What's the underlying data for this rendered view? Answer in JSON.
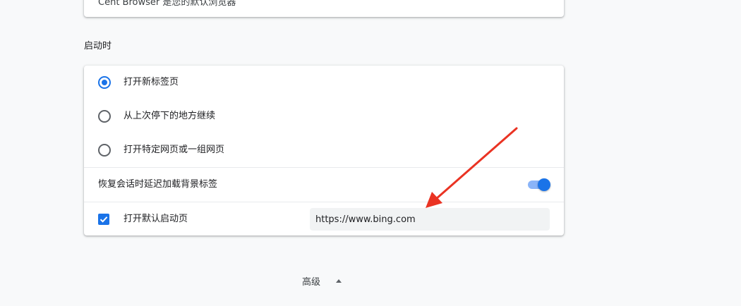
{
  "default_browser_card": {
    "text": "Cent Browser 是您的默认浏览器"
  },
  "startup": {
    "section_title": "启动时",
    "options": [
      {
        "label": "打开新标签页",
        "selected": true
      },
      {
        "label": "从上次停下的地方继续",
        "selected": false
      },
      {
        "label": "打开特定网页或一组网页",
        "selected": false
      }
    ],
    "lazy_load": {
      "label": "恢复会话时延迟加载背景标签",
      "enabled": true
    },
    "default_page": {
      "label": "打开默认启动页",
      "checked": true,
      "url": "https://www.bing.com"
    }
  },
  "advanced": {
    "label": "高级",
    "icon": "caret-up-icon"
  },
  "colors": {
    "accent": "#1a73e8",
    "toggle_track": "#8ab4f8",
    "annotation_arrow": "#ea3323"
  }
}
